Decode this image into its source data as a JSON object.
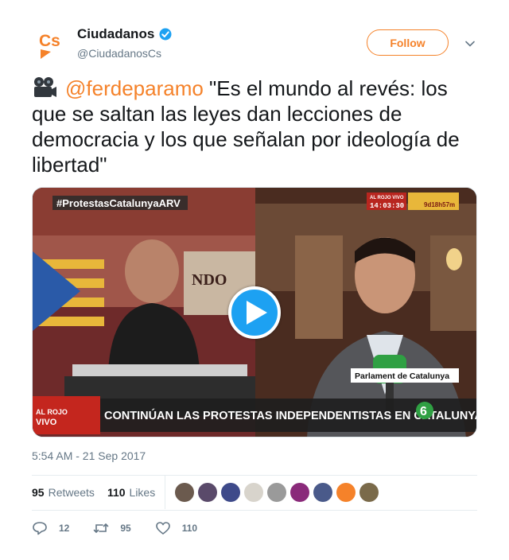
{
  "account": {
    "name": "Ciudadanos",
    "handle": "@CiudadanosCs",
    "logo_text": "Cs",
    "follow_label": "Follow"
  },
  "tweet": {
    "emoji": "🎥",
    "mention": "@ferdeparamo",
    "body": " \"Es el mundo al revés: los que se saltan las leyes dan lecciones de democracia y los que señalan por ideología de libertad\"",
    "timestamp": "5:54 AM - 21 Sep 2017"
  },
  "video": {
    "hashtag": "#ProtestasCatalunyaARV",
    "live_label": "AL ROJO VIVO",
    "clock": "14:03:30",
    "ticker_time": "9d18h57m",
    "location_caption": "Parlament de Catalunya",
    "headline": "CONTINÚAN LAS PROTESTAS INDEPENDENTISTAS EN CATALUNYA",
    "channel_logo": "6"
  },
  "stats": {
    "retweets_count": "95",
    "retweets_label": "Retweets",
    "likes_count": "110",
    "likes_label": "Likes"
  },
  "actions": {
    "replies": "12",
    "retweets": "95",
    "likes": "110"
  },
  "colors": {
    "brand_orange": "#f5822a",
    "verified_blue": "#1da1f2",
    "muted": "#657786"
  }
}
